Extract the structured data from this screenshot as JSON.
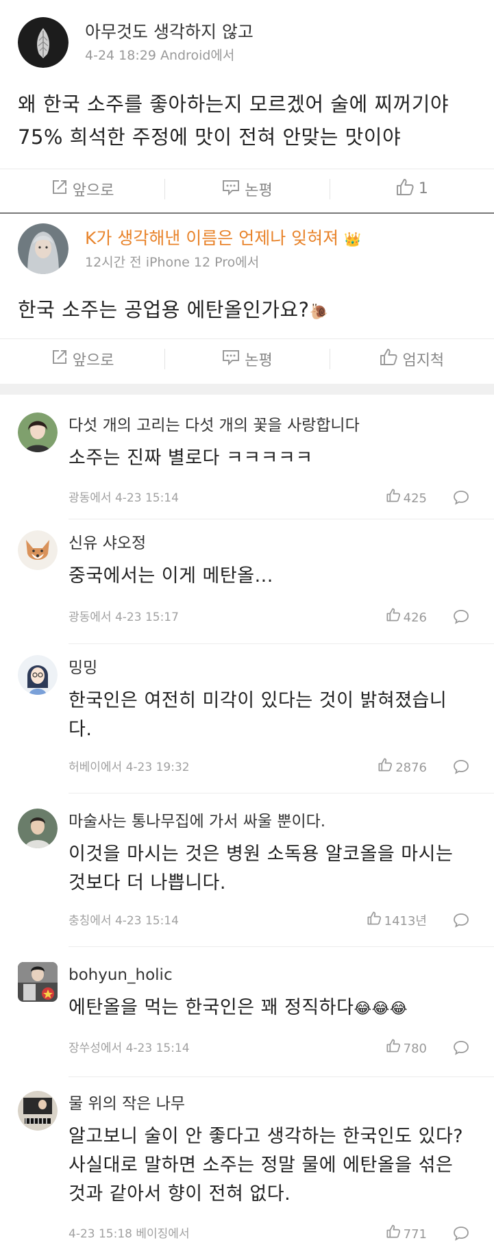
{
  "posts": [
    {
      "name": "아무것도 생각하지 않고",
      "time": "4-24 18:29 Android에서",
      "text_lines": [
        "왜 한국 소주를 좋아하는지 모르겠어 술에 찌꺼기야",
        "75% 희석한 주정에 맛이 전혀 안맞는 맛이야"
      ],
      "forward_label": "앞으로",
      "comment_label": "논평",
      "like_label": "1"
    },
    {
      "name": "K가 생각해낸 이름은 언제나 잊혀져",
      "name_emoji": "👑",
      "time": "12시간 전 iPhone 12 Pro에서",
      "text": "한국 소주는 공업용 에탄올인가요?",
      "text_emoji": "🐌",
      "forward_label": "앞으로",
      "comment_label": "논평",
      "like_label": "엄지척"
    }
  ],
  "comments": [
    {
      "name": "다섯 개의 고리는 다섯 개의 꽃을 사랑합니다",
      "text_lines": [
        "소주는 진짜 별로다 ㅋㅋㅋㅋㅋ"
      ],
      "loc": "광동에서 4-23 15:14",
      "likes": "425"
    },
    {
      "name": "신유 샤오정",
      "text_lines": [
        "중국에서는 이게 메탄올..."
      ],
      "loc": "광동에서 4-23 15:17",
      "likes": "426"
    },
    {
      "name": "밍밍",
      "text_lines": [
        "한국인은 여전히 미각이 있다는 것이 밝혀졌습니",
        "다."
      ],
      "loc": "허베이에서 4-23 19:32",
      "likes": "2876"
    },
    {
      "name": "마술사는 통나무집에 가서 싸울 뿐이다.",
      "text_lines": [
        "이것을 마시는 것은 병원 소독용 알코올을 마시는",
        "것보다 더 나쁩니다."
      ],
      "loc": "충칭에서 4-23 15:14",
      "likes": "1413년"
    },
    {
      "name": "bohyun_holic",
      "text_lines": [
        "에탄올을 먹는 한국인은 꽤 정직하다"
      ],
      "text_emoji": "😂😂😂",
      "loc": "장쑤성에서 4-23 15:14",
      "likes": "780"
    },
    {
      "name": "물 위의 작은 나무",
      "text_lines": [
        "알고보니 술이 안 좋다고 생각하는 한국인도 있다?",
        "사실대로 말하면 소주는 정말 물에 에탄올을 섞은",
        "것과 같아서 향이 전혀 없다."
      ],
      "loc": "4-23 15:18 베이징에서",
      "likes": "771"
    }
  ],
  "colors": {
    "accent_name": "#e8832a",
    "meta": "#999999",
    "divider": "#777777"
  },
  "icons": {
    "forward": "share-icon",
    "comment": "comment-icon",
    "like": "thumbs-up-icon",
    "reply": "reply-bubble-icon"
  }
}
